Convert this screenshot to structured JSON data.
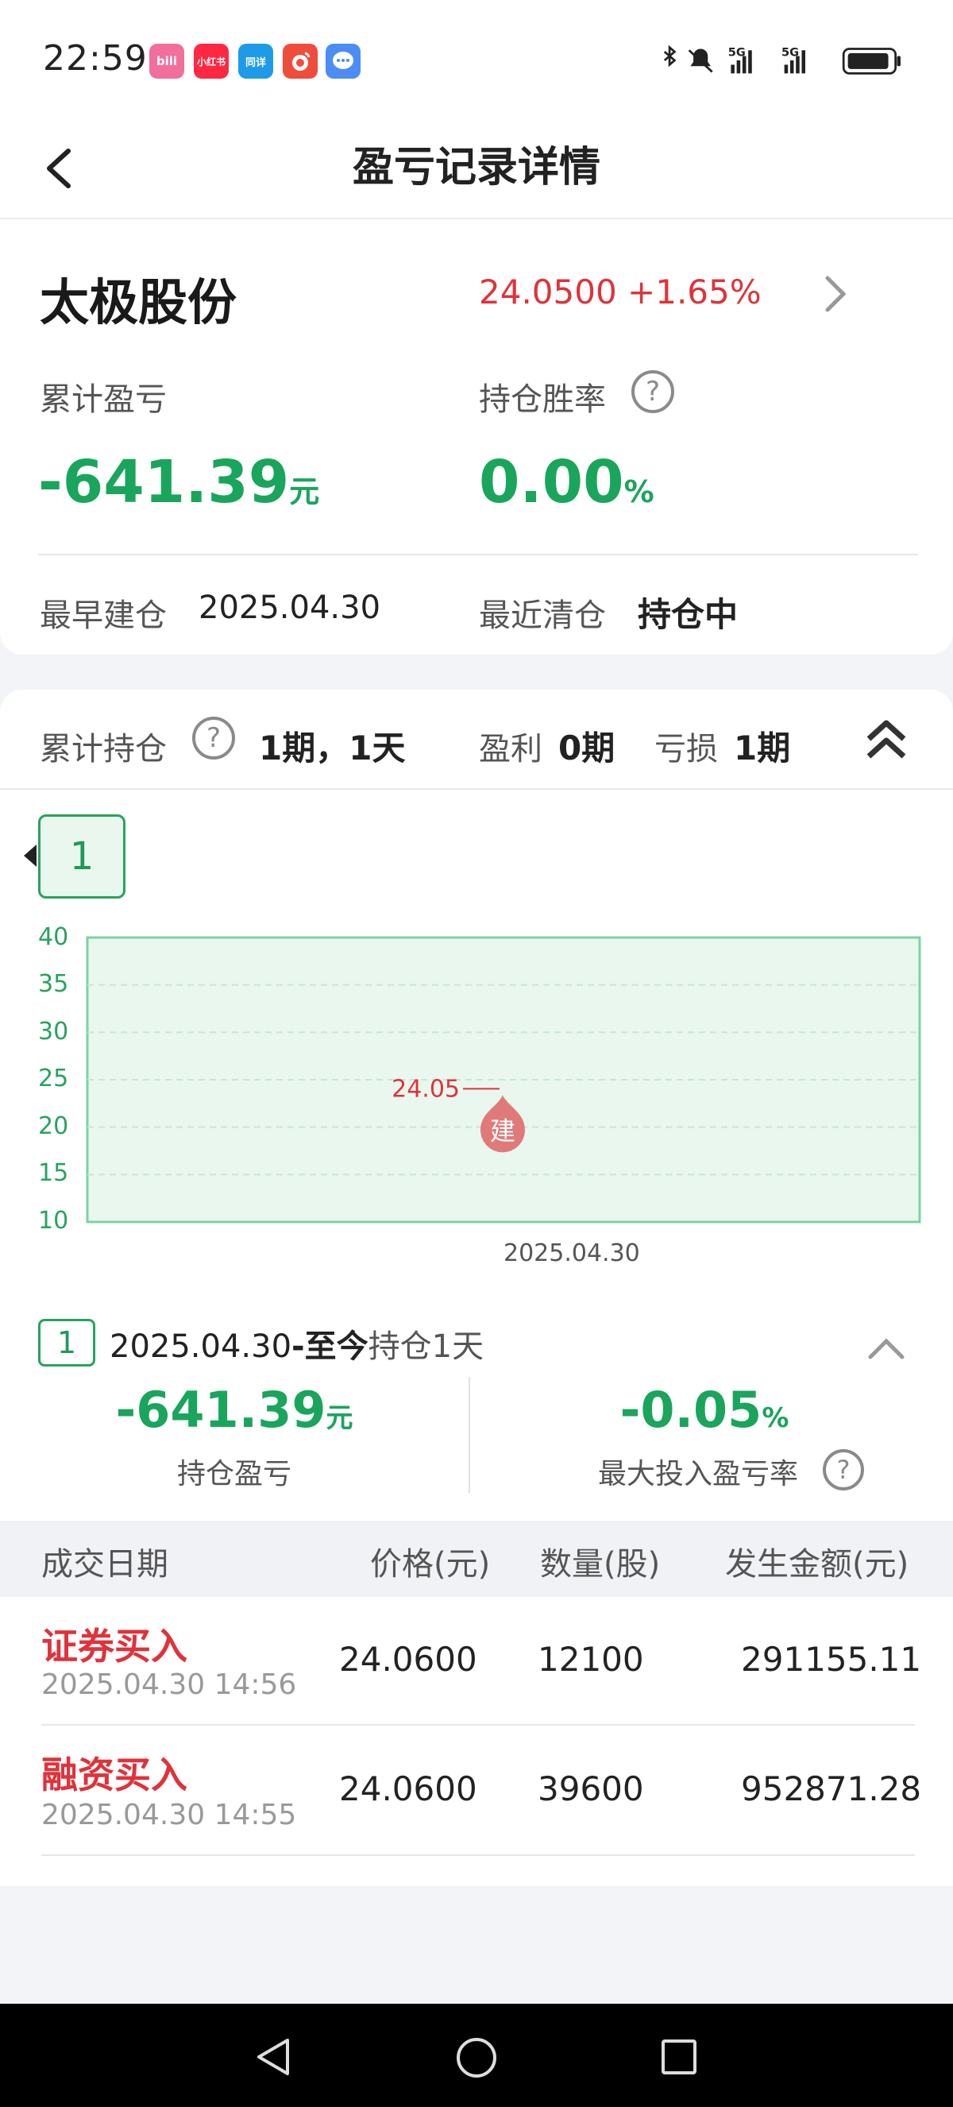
{
  "status_bar": {
    "time": "22:59",
    "apps": [
      {
        "icon": "bilibili-icon",
        "label": "bili",
        "color": "#f26e9c"
      },
      {
        "icon": "xiaohongshu-icon",
        "label": "小红书",
        "color": "#ff2741"
      },
      {
        "icon": "app-icon",
        "label": "同详",
        "color": "#1e9be8"
      },
      {
        "icon": "weibo-icon",
        "label": "",
        "color": "#f04c3c"
      },
      {
        "icon": "message-icon",
        "label": "",
        "color": "#4b8cf5"
      }
    ],
    "network": [
      "5G",
      "5G"
    ]
  },
  "header": {
    "title": "盈亏记录详情",
    "back_icon": "back-arrow-icon"
  },
  "stock": {
    "name": "太极股份",
    "price_change": "24.0500 +1.65%",
    "cum_pl_label": "累计盈亏",
    "cum_pl_value": "-641.39",
    "cum_pl_unit": "元",
    "win_rate_label": "持仓胜率",
    "win_rate_value": "0.00",
    "win_rate_unit": "%",
    "earliest_label": "最早建仓",
    "earliest_value": "2025.04.30",
    "recent_label": "最近清仓",
    "recent_value": "持仓中"
  },
  "holding_summary": {
    "label": "累计持仓",
    "value": "1期，1天",
    "profit_label": "盈利",
    "profit_value": "0期",
    "loss_label": "亏损",
    "loss_value": "1期"
  },
  "period_tab": "1",
  "chart_data": {
    "type": "line",
    "y_ticks": [
      "40",
      "35",
      "30",
      "25",
      "20",
      "15",
      "10"
    ],
    "ylim": [
      10,
      40
    ],
    "x_ticks": [
      "2025.04.30"
    ],
    "markers": [
      {
        "label": "建",
        "price": 24.05,
        "price_label": "24.05",
        "x": "2025.04.30"
      }
    ],
    "grid": true
  },
  "period_detail": {
    "index": "1",
    "range_start": "2025.04.30",
    "range_dash": "-",
    "range_end": "至今",
    "duration": "持仓1天",
    "holding_pl_value": "-641.39",
    "holding_pl_unit": "元",
    "holding_pl_label": "持仓盈亏",
    "max_rate_value": "-0.05",
    "max_rate_unit": "%",
    "max_rate_label": "最大投入盈亏率"
  },
  "table": {
    "headers": [
      "成交日期",
      "价格(元)",
      "数量(股)",
      "发生金额(元)"
    ],
    "rows": [
      {
        "type": "证券买入",
        "time": "2025.04.30 14:56",
        "price": "24.0600",
        "qty": "12100",
        "amount": "291155.11"
      },
      {
        "type": "融资买入",
        "time": "2025.04.30 14:55",
        "price": "24.0600",
        "qty": "39600",
        "amount": "952871.28"
      }
    ]
  },
  "colors": {
    "up": "#e0323a",
    "down": "#1aa55c",
    "accent": "#27a35d"
  }
}
